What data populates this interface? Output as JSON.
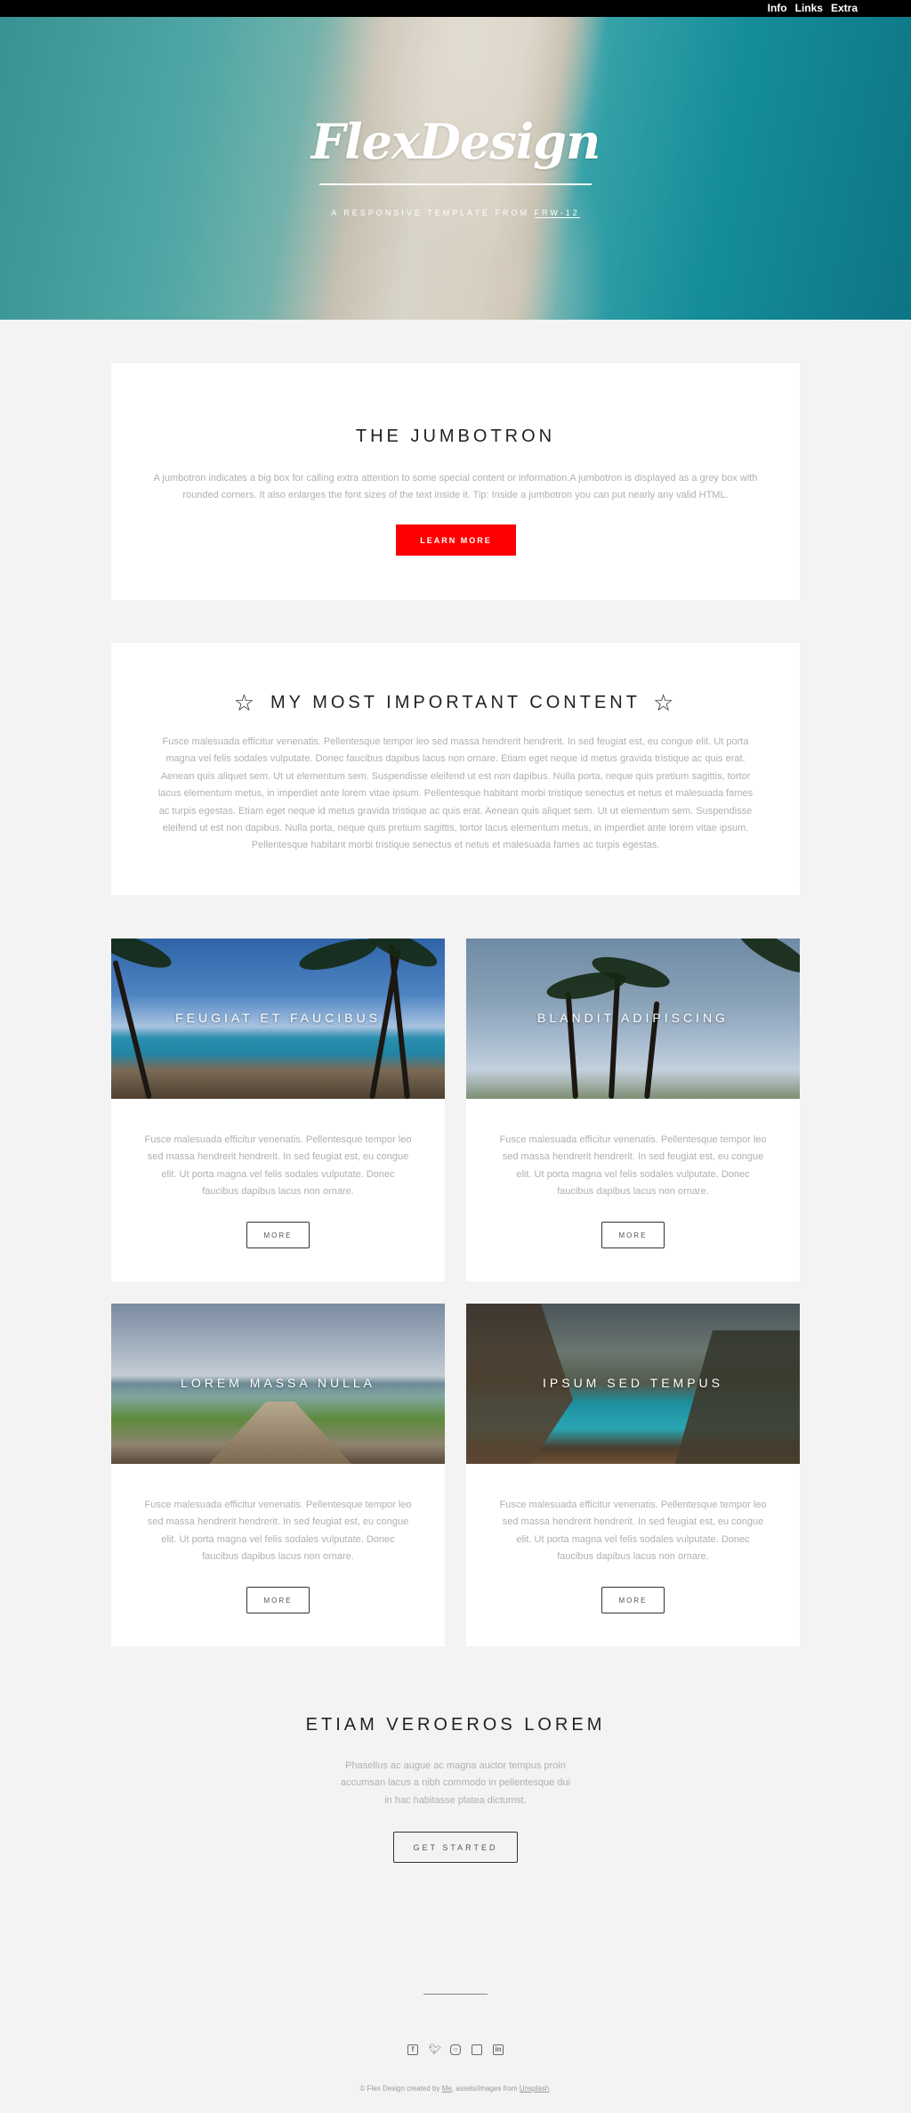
{
  "nav": {
    "items": [
      "Info",
      "Links",
      "Extra"
    ]
  },
  "hero": {
    "title": "FlexDesign",
    "subtitle_prefix": "A RESPONSIVE TEMPLATE FROM ",
    "subtitle_link": "FRW-12"
  },
  "jumbotron": {
    "title": "THE JUMBOTRON",
    "text": "A jumbotron indicates a big box for calling extra attention to some special content or information.A jumbotron is displayed as a grey box with rounded corners. It also enlarges the font sizes of the text inside it. Tip: Inside a jumbotron you can put nearly any valid HTML.",
    "button": "LEARN MORE"
  },
  "important": {
    "title": "MY MOST IMPORTANT CONTENT",
    "text": "Fusce malesuada efficitur venenatis. Pellentesque tempor leo sed massa hendrerit hendrerit. In sed feugiat est, eu congue elit. Ut porta magna vel felis sodales vulputate. Donec faucibus dapibus lacus non ornare. Etiam eget neque id metus gravida tristique ac quis erat. Aenean quis aliquet sem. Ut ut elementum sem. Suspendisse eleifend ut est non dapibus. Nulla porta, neque quis pretium sagittis, tortor lacus elementum metus, in imperdiet ante lorem vitae ipsum. Pellentesque habitant morbi tristique senectus et netus et malesuada fames ac turpis egestas. Etiam eget neque id metus gravida tristique ac quis erat. Aenean quis aliquet sem. Ut ut elementum sem. Suspendisse eleifend ut est non dapibus. Nulla porta, neque quis pretium sagittis, tortor lacus elementum metus, in imperdiet ante lorem vitae ipsum. Pellentesque habitant morbi tristique senectus et netus et malesuada fames ac turpis egestas."
  },
  "tiles": [
    {
      "caption": "FEUGIAT ET FAUCIBUS",
      "text": "Fusce malesuada efficitur venenatis. Pellentesque tempor leo sed massa hendrerit hendrerit. In sed feugiat est, eu congue elit. Ut porta magna vel felis sodales vulputate. Donec faucibus dapibus lacus non ornare.",
      "button": "MORE"
    },
    {
      "caption": "BLANDIT ADIPISCING",
      "text": "Fusce malesuada efficitur venenatis. Pellentesque tempor leo sed massa hendrerit hendrerit. In sed feugiat est, eu congue elit. Ut porta magna vel felis sodales vulputate. Donec faucibus dapibus lacus non ornare.",
      "button": "MORE"
    },
    {
      "caption": "LOREM MASSA NULLA",
      "text": "Fusce malesuada efficitur venenatis. Pellentesque tempor leo sed massa hendrerit hendrerit. In sed feugiat est, eu congue elit. Ut porta magna vel felis sodales vulputate. Donec faucibus dapibus lacus non ornare.",
      "button": "MORE"
    },
    {
      "caption": "IPSUM SED TEMPUS",
      "text": "Fusce malesuada efficitur venenatis. Pellentesque tempor leo sed massa hendrerit hendrerit. In sed feugiat est, eu congue elit. Ut porta magna vel felis sodales vulputate. Donec faucibus dapibus lacus non ornare.",
      "button": "MORE"
    }
  ],
  "cta": {
    "title": "ETIAM VEROEROS LOREM",
    "text": "Phasellus ac augue ac magna auctor tempus proin accumsan lacus a nibh commodo in pellentesque dui in hac habitasse platea dictumst.",
    "button": "GET STARTED"
  },
  "footer": {
    "socials": [
      "facebook-icon",
      "twitter-icon",
      "instagram-icon",
      "square-icon",
      "linkedin-icon"
    ],
    "copyright_prefix": "© Flex Design created by ",
    "copyright_me": "Me",
    "copyright_mid": ", assets/images from ",
    "copyright_link": "Unsplash",
    "copyright_end": "."
  },
  "colors": {
    "accent": "#ff0000",
    "background": "#f3f3f3",
    "topbar": "#000000"
  }
}
